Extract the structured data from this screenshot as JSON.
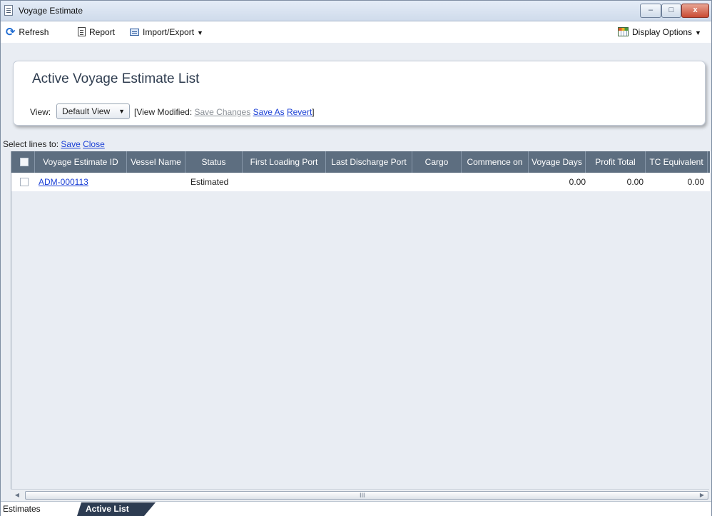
{
  "window": {
    "title": "Voyage Estimate",
    "controls": {
      "minimize": "–",
      "maximize": "□",
      "close": "x"
    }
  },
  "toolbar": {
    "refresh_label": "Refresh",
    "report_label": "Report",
    "import_export_label": "Import/Export",
    "display_options_label": "Display Options"
  },
  "panel": {
    "title": "Active Voyage Estimate List",
    "view_label": "View:",
    "view_selected": "Default View",
    "view_modified_prefix": "[View Modified:",
    "save_changes": "Save Changes",
    "save_as": "Save As",
    "revert": "Revert",
    "view_modified_suffix": "]"
  },
  "select_lines": {
    "prefix": "Select lines to:",
    "save": "Save",
    "close": "Close"
  },
  "grid": {
    "columns": [
      "Voyage Estimate ID",
      "Vessel Name",
      "Status",
      "First Loading Port",
      "Last Discharge Port",
      "Cargo",
      "Commence on",
      "Voyage Days",
      "Profit Total",
      "TC Equivalent"
    ],
    "rows": [
      {
        "voyage_estimate_id": "ADM-000113",
        "vessel_name": "",
        "status": "Estimated",
        "first_loading_port": "",
        "last_discharge_port": "",
        "cargo": "",
        "commence_on": "",
        "voyage_days": "0.00",
        "profit_total": "0.00",
        "tc_equivalent": "0.00"
      }
    ]
  },
  "scrollbar": {
    "grip": "III"
  },
  "tabs": [
    {
      "label": "Estimates",
      "active": false
    },
    {
      "label": "Active List",
      "active": true
    }
  ],
  "icons": {
    "app": "document-icon",
    "refresh": "refresh-icon",
    "report": "report-icon",
    "import_export": "import-export-icon",
    "display_options": "calculator-grid-icon"
  }
}
